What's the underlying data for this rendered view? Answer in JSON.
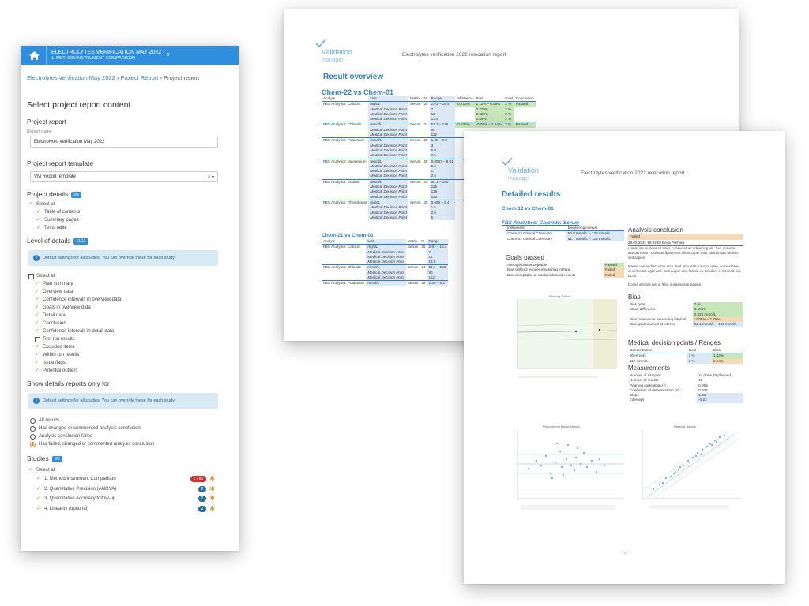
{
  "panel": {
    "project_title": "ELECTROLYTES VERIFICATION MAY 2022",
    "project_subtitle": "1. METHOD/INSTRUMENT COMPARISON",
    "breadcrumb": {
      "item1": "Electrolytes verification May 2022",
      "item2": "Project Report",
      "current": "Project report",
      "sep": "›"
    },
    "heading": "Select project report content",
    "project_report": {
      "title": "Project report",
      "name_label": "Report name",
      "name_value": "Electrolytes verification May 2022"
    },
    "template": {
      "title": "Project report template",
      "value": "VM ReportTemplate",
      "clear": "×"
    },
    "project_details": {
      "title": "Project details",
      "badge": "3/3",
      "items": [
        "Select all",
        "Table of contents",
        "Summary pages",
        "Tests table"
      ]
    },
    "level_of_details": {
      "title": "Level of details",
      "badge": "11/12",
      "info": "Default settings for all studies. You can override these for each study.",
      "select_all": "Select all",
      "items": [
        {
          "label": "Plan summary",
          "checked": true
        },
        {
          "label": "Overview data",
          "checked": true
        },
        {
          "label": "Confidence intervals in overview data",
          "checked": true
        },
        {
          "label": "Goals in overview data",
          "checked": true
        },
        {
          "label": "Detail data",
          "checked": true
        },
        {
          "label": "Conclusion",
          "checked": true
        },
        {
          "label": "Confidence intervals in detail data",
          "checked": true
        },
        {
          "label": "Test run results",
          "checked": false
        },
        {
          "label": "Excluded items",
          "checked": true
        },
        {
          "label": "Within run results",
          "checked": true
        },
        {
          "label": "Issue flags",
          "checked": true
        },
        {
          "label": "Potential outliers",
          "checked": true
        }
      ]
    },
    "details_only": {
      "title": "Show details reports only for",
      "info": "Default settings for all studies. You can override these for each study.",
      "options": [
        "All results",
        "Has changed or commented analysis conclusion",
        "Analysis conclusion failed",
        "Has failed, changed or commented analysis conclusion"
      ],
      "selected": 3
    },
    "studies": {
      "title": "Studies",
      "badge": "5/5",
      "select_all": "Select all",
      "items": [
        {
          "label": "1. Method/Instrument Comparison",
          "pill": "2 / 80",
          "pill_color": "#c9302c"
        },
        {
          "label": "2. Quantitative Precision (ANOVA)",
          "pill": "2",
          "pill_color": "#2c6e8f"
        },
        {
          "label": "3. Quantitative Accuracy follow-up",
          "pill": "2",
          "pill_color": "#2c6e8f"
        },
        {
          "label": "4. Linearity (optional)",
          "pill": "2",
          "pill_color": "#2c6e8f"
        }
      ]
    }
  },
  "report1": {
    "logo": "Validation",
    "logo_sub": "manager",
    "header": "Electrolytes verification 2022 relocation report",
    "section": "Result overview",
    "comp1": "Chem-22 vs Chem-01",
    "comp2": "Chem-21 vs Chem-01",
    "columns": [
      "Analyte",
      "Unit",
      "Matrix",
      "N",
      "Range",
      "Difference",
      "Bias",
      "Goal",
      "Conclusion"
    ],
    "rows": [
      {
        "a": "FBS Analytics: Calcium",
        "u": "mg/dL",
        "m": "Serum",
        "n": "25",
        "r": "2.91 – 18.4",
        "d": "-0.218%",
        "b": "1.11% – 0.55%",
        "g": "2 %",
        "c": "Passed"
      },
      {
        "a": "",
        "u": "Medical Decision Point",
        "m": "",
        "n": "",
        "r": "7",
        "d": "",
        "b": "0.726%",
        "g": "2 %",
        "c": ""
      },
      {
        "a": "",
        "u": "Medical Decision Point",
        "m": "",
        "n": "",
        "r": "11",
        "d": "",
        "b": "0.625%",
        "g": "2 %",
        "c": ""
      },
      {
        "a": "",
        "u": "Medical Decision Point",
        "m": "",
        "n": "",
        "r": "13.5",
        "d": "",
        "b": "0.59%",
        "g": "2 %",
        "c": ""
      },
      {
        "a": "FBS Analytics: Chloride",
        "u": "mmol/L",
        "m": "Serum",
        "n": "24",
        "r": "51.7 – 125",
        "d": "-0.876%",
        "b": "-0.05% – 1.61%",
        "g": "2 %",
        "c": "Passed"
      },
      {
        "a": "",
        "u": "Medical Decision Point",
        "m": "",
        "n": "",
        "r": "90",
        "d": "",
        "b": "",
        "g": "",
        "c": ""
      },
      {
        "a": "",
        "u": "Medical Decision Point",
        "m": "",
        "n": "",
        "r": "112",
        "d": "",
        "b": "",
        "g": "",
        "c": ""
      },
      {
        "a": "FBS Analytics: Potassium",
        "u": "mmol/L",
        "m": "Serum",
        "n": "25",
        "r": "1.45 – 9.2",
        "d": "",
        "b": "",
        "g": "",
        "c": ""
      },
      {
        "a": "",
        "u": "Medical Decision Point",
        "m": "",
        "n": "",
        "r": "3",
        "d": "",
        "b": "",
        "g": "",
        "c": ""
      },
      {
        "a": "",
        "u": "Medical Decision Point",
        "m": "",
        "n": "",
        "r": "5.8",
        "d": "",
        "b": "",
        "g": "",
        "c": ""
      },
      {
        "a": "",
        "u": "Medical Decision Point",
        "m": "",
        "n": "",
        "r": "7.5",
        "d": "",
        "b": "",
        "g": "",
        "c": ""
      },
      {
        "a": "FBS Analytics: Magnesium",
        "u": "mmol/L",
        "m": "Serum",
        "n": "25",
        "r": "0.0967 – 8.91",
        "d": "",
        "b": "",
        "g": "",
        "c": ""
      },
      {
        "a": "",
        "u": "Medical Decision Point",
        "m": "",
        "n": "",
        "r": "0.6",
        "d": "",
        "b": "",
        "g": "",
        "c": ""
      },
      {
        "a": "",
        "u": "Medical Decision Point",
        "m": "",
        "n": "",
        "r": "1",
        "d": "",
        "b": "",
        "g": "",
        "c": ""
      },
      {
        "a": "",
        "u": "Medical Decision Point",
        "m": "",
        "n": "",
        "r": "2.5",
        "d": "",
        "b": "",
        "g": "",
        "c": ""
      },
      {
        "a": "FBS Analytics: Sodium",
        "u": "mmol/L",
        "m": "Serum",
        "n": "25",
        "r": "60.1 – 190",
        "d": "",
        "b": "",
        "g": "",
        "c": ""
      },
      {
        "a": "",
        "u": "Medical Decision Point",
        "m": "",
        "n": "",
        "r": "115",
        "d": "",
        "b": "",
        "g": "",
        "c": ""
      },
      {
        "a": "",
        "u": "Medical Decision Point",
        "m": "",
        "n": "",
        "r": "135",
        "d": "",
        "b": "",
        "g": "",
        "c": ""
      },
      {
        "a": "",
        "u": "Medical Decision Point",
        "m": "",
        "n": "",
        "r": "150",
        "d": "",
        "b": "",
        "g": "",
        "c": ""
      },
      {
        "a": "FBS Analytics: Phosphorus",
        "u": "mg/dL",
        "m": "Serum",
        "n": "25",
        "r": "0.699 – 9.4",
        "d": "",
        "b": "",
        "g": "",
        "c": ""
      },
      {
        "a": "",
        "u": "Medical Decision Point",
        "m": "",
        "n": "",
        "r": "1.5",
        "d": "",
        "b": "",
        "g": "",
        "c": ""
      },
      {
        "a": "",
        "u": "Medical Decision Point",
        "m": "",
        "n": "",
        "r": "2.5",
        "d": "",
        "b": "",
        "g": "",
        "c": ""
      },
      {
        "a": "",
        "u": "Medical Decision Point",
        "m": "",
        "n": "",
        "r": "5",
        "d": "",
        "b": "",
        "g": "",
        "c": ""
      }
    ],
    "rows2": [
      {
        "a": "FBS Analytics: Calcium",
        "u": "mg/dL",
        "m": "Serum",
        "n": "25",
        "r": "2.91 – 18.4"
      },
      {
        "a": "",
        "u": "Medical Decision Point",
        "m": "",
        "n": "",
        "r": "7"
      },
      {
        "a": "",
        "u": "Medical Decision Point",
        "m": "",
        "n": "",
        "r": "11"
      },
      {
        "a": "",
        "u": "Medical Decision Point",
        "m": "",
        "n": "",
        "r": "13.5"
      },
      {
        "a": "FBS Analytics: Chloride",
        "u": "mmol/L",
        "m": "Serum",
        "n": "24",
        "r": "51.7 – 125"
      },
      {
        "a": "",
        "u": "Medical Decision Point",
        "m": "",
        "n": "",
        "r": "90"
      },
      {
        "a": "",
        "u": "Medical Decision Point",
        "m": "",
        "n": "",
        "r": "112"
      },
      {
        "a": "FBS Analytics: Potassium",
        "u": "mmol/L",
        "m": "Serum",
        "n": "25",
        "r": "1.45 – 9.2"
      }
    ]
  },
  "report2": {
    "logo": "Validation",
    "logo_sub": "manager",
    "header": "Electrolytes verification 2022 relocation report",
    "section": "Detailed results",
    "comparison": "Chem-12 vs Chem-01",
    "analyte": "FBS Analytics: Chloride: Serum",
    "instrument_header": [
      "Instrument",
      "Measuring interval"
    ],
    "instrument_rows": [
      [
        "Chem-12 Clinical Chemistry",
        "50.8 mmol/L – 129 mmol/L"
      ],
      [
        "Chem-01 Clinical Chemistry",
        "51.7 mmol/L – 125 mmol/L"
      ]
    ],
    "goals_title": "Goals passed",
    "goals": [
      [
        "Average bias acceptable",
        "Passed"
      ],
      [
        "Bias within 2 % over measuring interval",
        "Failed"
      ],
      [
        "Bias acceptable at medical decision points",
        "Failed"
      ]
    ],
    "conclusion_title": "Analysis conclusion",
    "conclusion_status": "Failed",
    "conclusion_meta": "28.02.2022 18:02 by Eeva Purhola",
    "conclusion_p1": "Lorem ipsum dolor sit amet, consectetuer adipiscing elit. Sed posuere interdum sem. Quisque ligula eros ullamcorper quis, lacinia quis facilisis sed sapien.",
    "conclusion_p2": "Mauris varius diam vitae arcu. Sed arcu lectus auctor vitae, consectetuer et venenatis eget velit. Sed augue orci, lacinia eu tincidunt et eleifend nec lacus.",
    "conclusion_p3": "Donec ultricies nisl ut felis, suspendisse potenti.",
    "bias_title": "Bias",
    "bias": [
      [
        "Bias goal",
        "2 %"
      ],
      [
        "Mean difference",
        "0.106%"
      ],
      [
        "",
        "0.425 mmol/L"
      ],
      [
        "Bias over whole measuring interval",
        "-2.05% – 2.75%"
      ],
      [
        "Bias goal reached at interval",
        "52.1 mmol/L – 103 mmol/L"
      ]
    ],
    "mdp_title": "Medical decision points / Ranges",
    "mdp_header": [
      "Concentration",
      "Goal",
      "Bias"
    ],
    "mdp": [
      [
        "90 mmol/L",
        "2 %",
        "1.42%"
      ],
      [
        "112 mmol/L",
        "2 %",
        "2.54%"
      ]
    ],
    "meas_title": "Measurements",
    "meas": [
      [
        "Number of samples",
        "24 done  25 planned"
      ],
      [
        "Number of results",
        "48"
      ],
      [
        "Pearson correlation (r)",
        "0.999"
      ],
      [
        "Coefficient of determination (r²)",
        "0.924"
      ],
      [
        "Slope",
        "1.08"
      ],
      [
        "Intercept",
        "-4.23"
      ]
    ],
    "chart1_title": "Passing-Bablok",
    "chart2_title": "Proportional Bland-Altman",
    "chart3_title": "Passing-Bablok",
    "page_number": "10"
  }
}
